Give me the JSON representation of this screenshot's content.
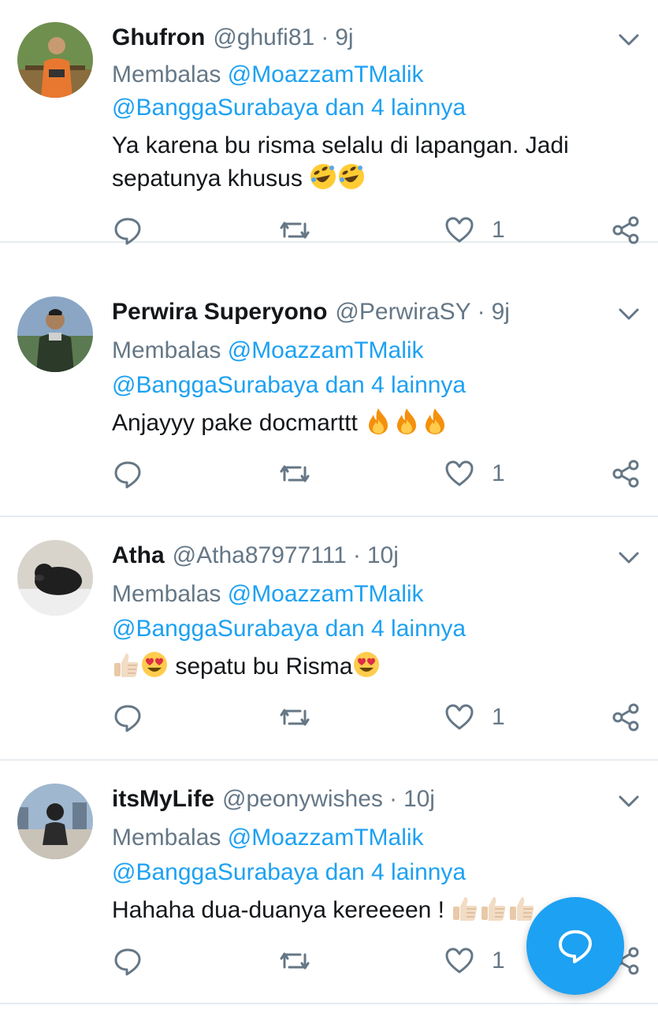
{
  "reply_prefix": "Membalas",
  "tweets": [
    {
      "name": "Ghufron",
      "handle": "@ghufi81",
      "time": "9j",
      "reply_to": "@MoazzamTMalik",
      "reply_others": "@BanggaSurabaya dan 4 lainnya",
      "text_line1": "Ya karena bu risma selalu di lapangan. Jadi",
      "text_line2": "sepatunya khusus",
      "emojis": [
        "rolling-on-floor-laughing",
        "rolling-on-floor-laughing"
      ],
      "like_count": "1"
    },
    {
      "name": "Perwira Superyono",
      "handle": "@PerwiraSY",
      "time": "9j",
      "reply_to": "@MoazzamTMalik",
      "reply_others": "@BanggaSurabaya dan 4 lainnya",
      "text_line1": "Anjayyy pake docmarttt",
      "emojis": [
        "fire",
        "fire",
        "fire"
      ],
      "like_count": "1"
    },
    {
      "name": "Atha",
      "handle": "@Atha87977111",
      "time": "10j",
      "reply_to": "@MoazzamTMalik",
      "reply_others": "@BanggaSurabaya dan 4 lainnya",
      "text_line1": "sepatu bu Risma",
      "emojis": [
        "thumbs-up",
        "heart-eyes",
        "heart-eyes"
      ],
      "like_count": "1"
    },
    {
      "name": "itsMyLife",
      "handle": "@peonywishes",
      "time": "10j",
      "reply_to": "@MoazzamTMalik",
      "reply_others": "@BanggaSurabaya dan 4 lainnya",
      "text_line1": "Hahaha dua-duanya kereeeen !",
      "emojis": [
        "thumbs-up",
        "thumbs-up",
        "thumbs-up"
      ],
      "like_count": "1"
    }
  ],
  "icons": {
    "reply": "reply-icon",
    "retweet": "retweet-icon",
    "like": "heart-icon",
    "share": "share-icon",
    "menu": "chevron-down-icon",
    "compose": "compose-reply-icon"
  },
  "colors": {
    "accent": "#1da1f2",
    "secondary_text": "#657786",
    "primary_text": "#14171a",
    "divider": "#e6ecf0"
  }
}
